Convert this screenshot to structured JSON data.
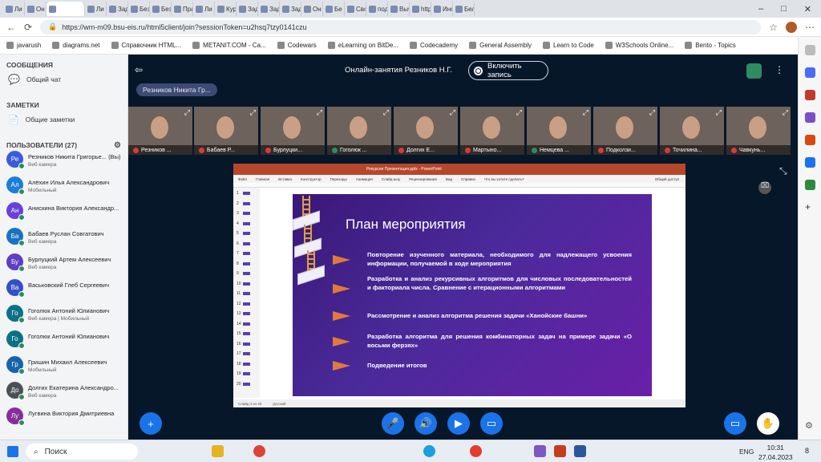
{
  "browser": {
    "tabs": [
      "Ли",
      "Он",
      "",
      "Ли",
      "Зад",
      "Без",
      "Без",
      "Пра",
      "Ли",
      "Кур",
      "Зад",
      "Зад",
      "Зад",
      "Он",
      "Бе",
      "Сво",
      "под",
      "Выч",
      "http",
      "Ино",
      "Бел"
    ],
    "active_tab": "",
    "url": "https://wm-m09.bsu-eis.ru/html5client/join?sessionToken=u2hsq7tzy0141czu",
    "bookmarks": [
      "javarush",
      "diagrams.net",
      "Справочник HTML...",
      "METANIT.COM - Са...",
      "Codewars",
      "eLearning on BitDe...",
      "Codecademy",
      "General Assembly",
      "Learn to Code",
      "W3Schools Online...",
      "Bento - Topics"
    ]
  },
  "left": {
    "messages_title": "СООБЩЕНИЯ",
    "public_chat": "Общий чат",
    "notes_title": "ЗАМЕТКИ",
    "shared_notes": "Общие заметки",
    "users_title": "ПОЛЬЗОВАТЕЛИ (27)",
    "users": [
      {
        "initials": "Ре",
        "name": "Резников Никита Григорье... (Вы)",
        "sub": "Веб камера",
        "color": "#3b5bdb"
      },
      {
        "initials": "Ал",
        "name": "Алёхин Илья Александрович",
        "sub": "Мобильный",
        "color": "#1c7ed6"
      },
      {
        "initials": "Ан",
        "name": "Анискина Виктория Александр...",
        "sub": "",
        "color": "#6741d9"
      },
      {
        "initials": "Ба",
        "name": "Бабаев Руслан Совгатович",
        "sub": "Веб камера",
        "color": "#1971c2"
      },
      {
        "initials": "Бу",
        "name": "Бурлуцкий Артем Алексеевич",
        "sub": "Веб камера",
        "color": "#5f3dc4"
      },
      {
        "initials": "Ва",
        "name": "Васьковский Глеб Сергеевич",
        "sub": "",
        "color": "#364fc7"
      },
      {
        "initials": "Го",
        "name": "Гоголюк Антоний Юлианович",
        "sub": "Веб камера | Мобильный",
        "color": "#0b7285"
      },
      {
        "initials": "Го",
        "name": "Гоголюк Антоний Юлианович",
        "sub": "",
        "color": "#0b7285"
      },
      {
        "initials": "Гр",
        "name": "Гришин Михаил Алексеевич",
        "sub": "Мобильный",
        "color": "#1864ab"
      },
      {
        "initials": "До",
        "name": "Долгих Екатерина Александро...",
        "sub": "Веб камера",
        "color": "#495057"
      },
      {
        "initials": "Лу",
        "name": "Лугвина Виктория Дмитриевна",
        "sub": "",
        "color": "#862e9c"
      }
    ]
  },
  "meeting": {
    "title": "Онлайн-занятия Резников Н.Г.",
    "record_label": "Включить запись",
    "presenter": "Резников Никита Гр...",
    "videos": [
      {
        "name": "Резников ...",
        "mic": "off"
      },
      {
        "name": "Бабаев Р...",
        "mic": "off"
      },
      {
        "name": "Бурлуцки...",
        "mic": "off"
      },
      {
        "name": "Гоголюк ...",
        "mic": "on"
      },
      {
        "name": "Долгих Е...",
        "mic": "off"
      },
      {
        "name": "Мартыно...",
        "mic": "off"
      },
      {
        "name": "Немцева ...",
        "mic": "on"
      },
      {
        "name": "Подколзи...",
        "mic": "off"
      },
      {
        "name": "Точилина...",
        "mic": "off"
      },
      {
        "name": "Чавкунь...",
        "mic": "off"
      }
    ]
  },
  "slide": {
    "title": "План мероприятия",
    "ppt_titlebar": "Рекурсия Презентация.pptx - PowerPoint",
    "ppt_menu": [
      "Файл",
      "Главная",
      "Вставка",
      "Конструктор",
      "Переходы",
      "Анимация",
      "Слайд-шоу",
      "Рецензирование",
      "Вид",
      "Справка",
      "Что вы хотите сделать?"
    ],
    "ppt_share": "Общий доступ",
    "ppt_status": "Слайд 4 из 20",
    "ppt_lang": "русский",
    "slide_numbers": [
      "1",
      "2",
      "3",
      "4",
      "5",
      "6",
      "7",
      "8",
      "9",
      "10",
      "11",
      "12",
      "13",
      "14",
      "15",
      "16",
      "17",
      "18",
      "19",
      "20"
    ],
    "bullets": [
      "Повторение изученного материала, необходимого для надлежащего усвоения информации, получаемой в ходе мероприятия",
      "Разработка и анализ рекурсивных алгоритмов для числовых последовательностей и факториала числа. Сравнение с итерационными алгоритмами",
      "Рассмотрение и анализ алгоритма решения задачи «Ханойские башни»",
      "Разработка алгоритма для решения комбинаторных задач на примере задачи «О восьми ферзях»",
      "Подведение итогов"
    ]
  },
  "taskbar": {
    "search": "Поиск",
    "lang": "ENG",
    "time": "10:31",
    "date": "27.04.2023",
    "badge": "8"
  }
}
